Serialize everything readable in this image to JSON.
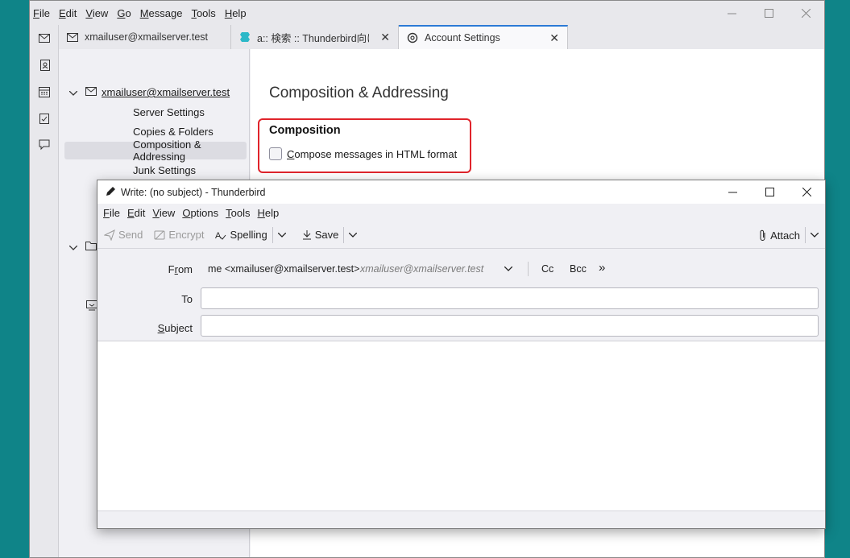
{
  "main_window": {
    "menu": [
      {
        "label": "File",
        "key": "F",
        "rest": "ile"
      },
      {
        "label": "Edit",
        "key": "E",
        "rest": "dit"
      },
      {
        "label": "View",
        "key": "V",
        "rest": "iew"
      },
      {
        "label": "Go",
        "key": "G",
        "rest": "o"
      },
      {
        "label": "Message",
        "key": "M",
        "rest": "essage"
      },
      {
        "label": "Tools",
        "key": "T",
        "rest": "ools"
      },
      {
        "label": "Help",
        "key": "H",
        "rest": "elp"
      }
    ],
    "tabs": [
      {
        "label": "xmailuser@xmailserver.test",
        "icon": "mail-icon"
      },
      {
        "label": "a:: 検索 :: Thunderbird向けア",
        "icon": "addon-puzzle-icon"
      },
      {
        "label": "Account Settings",
        "icon": "settings-icon",
        "active": true
      }
    ],
    "sidebar": {
      "account_name": "xmailuser@xmailserver.test",
      "items": [
        {
          "label": "Server Settings"
        },
        {
          "label": "Copies & Folders"
        },
        {
          "label": "Composition & Addressing",
          "selected": true
        },
        {
          "label": "Junk Settings"
        }
      ]
    },
    "content": {
      "heading": "Composition & Addressing",
      "section_title": "Composition",
      "html_checkbox_prefix": "C",
      "html_checkbox_rest": "ompose messages in HTML format",
      "html_checkbox_checked": false,
      "highlight_color": "#e0242b"
    }
  },
  "compose_window": {
    "title": "Write: (no subject) - Thunderbird",
    "menu": [
      {
        "key": "F",
        "rest": "ile"
      },
      {
        "key": "E",
        "rest": "dit"
      },
      {
        "key": "V",
        "rest": "iew"
      },
      {
        "key": "O",
        "rest": "ptions"
      },
      {
        "key": "T",
        "rest": "ools"
      },
      {
        "key": "H",
        "rest": "elp"
      }
    ],
    "toolbar": {
      "send": "Send",
      "encrypt": "Encrypt",
      "spelling": "Spelling",
      "save": "Save",
      "attach": "Attach"
    },
    "headers": {
      "from_label_key": "r",
      "from_identity": "me <xmailuser@xmailserver.test>",
      "from_email": "xmailuser@xmailserver.test",
      "cc": "Cc",
      "bcc": "Bcc",
      "more": "»",
      "to_label": "To",
      "subject_label_key": "S",
      "subject_label_rest": "ubject",
      "to_value": "",
      "subject_value": ""
    }
  },
  "colors": {
    "desktop": "#0f8488",
    "accent": "#2b7ad6"
  }
}
